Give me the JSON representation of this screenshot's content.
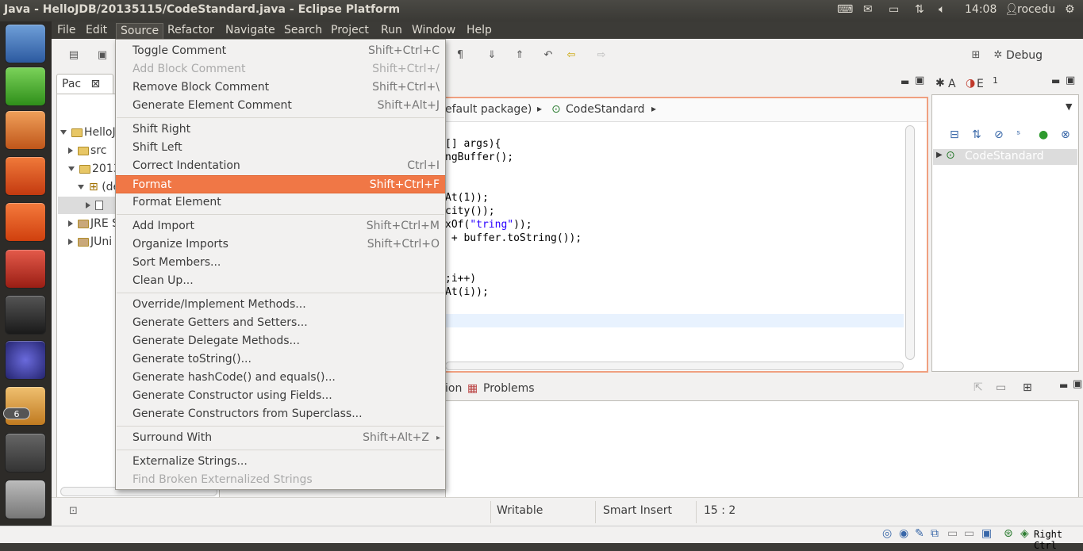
{
  "window": {
    "title": "Java - HelloJDB/20135115/CodeStandard.java - Eclipse Platform"
  },
  "indicators": {
    "time": "14:08",
    "user": "rocedu"
  },
  "menubar": [
    "File",
    "Edit",
    "Source",
    "Refactor",
    "Navigate",
    "Search",
    "Project",
    "Run",
    "Window",
    "Help"
  ],
  "source_menu": {
    "g1": [
      {
        "label": "Toggle Comment",
        "shortcut": "Shift+Ctrl+C"
      },
      {
        "label": "Add Block Comment",
        "shortcut": "Shift+Ctrl+/"
      },
      {
        "label": "Remove Block Comment",
        "shortcut": "Shift+Ctrl+\\"
      },
      {
        "label": "Generate Element Comment",
        "shortcut": "Shift+Alt+J"
      }
    ],
    "g2": [
      {
        "label": "Shift Right",
        "shortcut": ""
      },
      {
        "label": "Shift Left",
        "shortcut": ""
      },
      {
        "label": "Correct Indentation",
        "shortcut": "Ctrl+I"
      },
      {
        "label": "Format",
        "shortcut": "Shift+Ctrl+F"
      },
      {
        "label": "Format Element",
        "shortcut": ""
      }
    ],
    "g3": [
      {
        "label": "Add Import",
        "shortcut": "Shift+Ctrl+M"
      },
      {
        "label": "Organize Imports",
        "shortcut": "Shift+Ctrl+O"
      },
      {
        "label": "Sort Members...",
        "shortcut": ""
      },
      {
        "label": "Clean Up...",
        "shortcut": ""
      }
    ],
    "g4": [
      {
        "label": "Override/Implement Methods...",
        "shortcut": ""
      },
      {
        "label": "Generate Getters and Setters...",
        "shortcut": ""
      },
      {
        "label": "Generate Delegate Methods...",
        "shortcut": ""
      },
      {
        "label": "Generate toString()...",
        "shortcut": ""
      },
      {
        "label": "Generate hashCode() and equals()...",
        "shortcut": ""
      },
      {
        "label": "Generate Constructor using Fields...",
        "shortcut": ""
      },
      {
        "label": "Generate Constructors from Superclass...",
        "shortcut": ""
      }
    ],
    "g5": [
      {
        "label": "Surround With",
        "shortcut": "Shift+Alt+Z"
      }
    ],
    "g6": [
      {
        "label": "Externalize Strings...",
        "shortcut": ""
      },
      {
        "label": "Find Broken Externalized Strings",
        "shortcut": ""
      }
    ]
  },
  "perspective": {
    "debug_label": "Debug"
  },
  "package_explorer": {
    "tab_label": "Pac",
    "tree": [
      "HelloJ",
      "src",
      "2013",
      "(de",
      "JRE S",
      "JUni"
    ]
  },
  "breadcrumb": {
    "package": "efault package)",
    "class": "CodeStandard"
  },
  "code": {
    "lines": [
      "[] args){",
      "ngBuffer();",
      "At(1));",
      "city());",
      "xOf(",
      "\"tring\"",
      "));",
      " + buffer.toString());",
      ";i++)",
      "At(i));"
    ]
  },
  "outline": {
    "tab_a": "A",
    "tab_e": "E",
    "tab_count": "1",
    "item": "CodeStandard"
  },
  "bottom_panel": {
    "tab_partial": "ion",
    "tab_problems": "Problems"
  },
  "status": {
    "writable": "Writable",
    "insert_mode": "Smart Insert",
    "position": "15 : 2"
  },
  "launcher": {
    "badge": "6"
  },
  "taskbar": {
    "right_ctrl": "Right Ctrl"
  },
  "colors": {
    "highlight": "#f07746",
    "menubar_bg": "#3c3b37",
    "launcher_bg": "#2d2b28"
  }
}
